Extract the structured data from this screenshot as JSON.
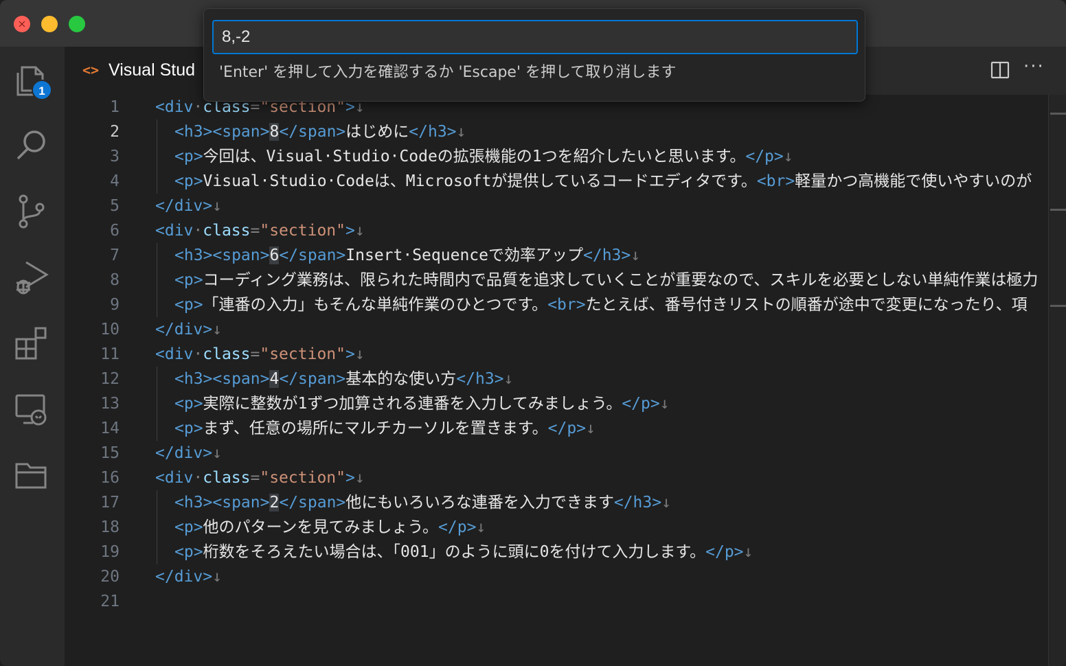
{
  "tab": {
    "label": "Visual Stud",
    "icon": "html-file-icon"
  },
  "activity_bar": {
    "items": [
      {
        "name": "explorer-icon",
        "badge": "1"
      },
      {
        "name": "search-icon"
      },
      {
        "name": "source-control-icon"
      },
      {
        "name": "run-debug-icon"
      },
      {
        "name": "extensions-icon"
      },
      {
        "name": "remote-explorer-icon"
      },
      {
        "name": "folder-icon"
      }
    ]
  },
  "quick_input": {
    "value": "8,-2",
    "hint": "'Enter' を押して入力を確認するか 'Escape' を押して取り消します"
  },
  "editor": {
    "active_line": 2,
    "lines": [
      {
        "n": "1",
        "indent": false,
        "parts": [
          [
            "tag",
            "<div"
          ],
          [
            "punct",
            "·"
          ],
          [
            "attr",
            "class"
          ],
          [
            "punct",
            "="
          ],
          [
            "str",
            "\"section\""
          ],
          [
            "tag",
            ">"
          ],
          [
            "eol",
            "↓"
          ]
        ]
      },
      {
        "n": "2",
        "indent": true,
        "parts": [
          [
            "tag",
            "<h3>"
          ],
          [
            "tag",
            "<span>"
          ],
          [
            "sel",
            "8"
          ],
          [
            "tag",
            "</span>"
          ],
          [
            "txt",
            "はじめに"
          ],
          [
            "tag",
            "</h3>"
          ],
          [
            "eol",
            "↓"
          ]
        ]
      },
      {
        "n": "3",
        "indent": true,
        "parts": [
          [
            "tag",
            "<p>"
          ],
          [
            "txt",
            "今回は、Visual·Studio·Codeの拡張機能の1つを紹介したいと思います。"
          ],
          [
            "tag",
            "</p>"
          ],
          [
            "eol",
            "↓"
          ]
        ]
      },
      {
        "n": "4",
        "indent": true,
        "parts": [
          [
            "tag",
            "<p>"
          ],
          [
            "txt",
            "Visual·Studio·Codeは、Microsoftが提供しているコードエディタです。"
          ],
          [
            "tag",
            "<br>"
          ],
          [
            "txt",
            "軽量かつ高機能で使いやすいのが"
          ]
        ]
      },
      {
        "n": "5",
        "indent": false,
        "parts": [
          [
            "tag",
            "</div>"
          ],
          [
            "eol",
            "↓"
          ]
        ]
      },
      {
        "n": "6",
        "indent": false,
        "parts": [
          [
            "tag",
            "<div"
          ],
          [
            "punct",
            "·"
          ],
          [
            "attr",
            "class"
          ],
          [
            "punct",
            "="
          ],
          [
            "str",
            "\"section\""
          ],
          [
            "tag",
            ">"
          ],
          [
            "eol",
            "↓"
          ]
        ]
      },
      {
        "n": "7",
        "indent": true,
        "parts": [
          [
            "tag",
            "<h3>"
          ],
          [
            "tag",
            "<span>"
          ],
          [
            "sel",
            "6"
          ],
          [
            "tag",
            "</span>"
          ],
          [
            "txt",
            "Insert·Sequenceで効率アップ"
          ],
          [
            "tag",
            "</h3>"
          ],
          [
            "eol",
            "↓"
          ]
        ]
      },
      {
        "n": "8",
        "indent": true,
        "parts": [
          [
            "tag",
            "<p>"
          ],
          [
            "txt",
            "コーディング業務は、限られた時間内で品質を追求していくことが重要なので、スキルを必要としない単純作業は極力"
          ]
        ]
      },
      {
        "n": "9",
        "indent": true,
        "parts": [
          [
            "tag",
            "<p>"
          ],
          [
            "txt",
            "「連番の入力」もそんな単純作業のひとつです。"
          ],
          [
            "tag",
            "<br>"
          ],
          [
            "txt",
            "たとえば、番号付きリストの順番が途中で変更になったり、項"
          ]
        ]
      },
      {
        "n": "10",
        "indent": false,
        "parts": [
          [
            "tag",
            "</div>"
          ],
          [
            "eol",
            "↓"
          ]
        ]
      },
      {
        "n": "11",
        "indent": false,
        "parts": [
          [
            "tag",
            "<div"
          ],
          [
            "punct",
            "·"
          ],
          [
            "attr",
            "class"
          ],
          [
            "punct",
            "="
          ],
          [
            "str",
            "\"section\""
          ],
          [
            "tag",
            ">"
          ],
          [
            "eol",
            "↓"
          ]
        ]
      },
      {
        "n": "12",
        "indent": true,
        "parts": [
          [
            "tag",
            "<h3>"
          ],
          [
            "tag",
            "<span>"
          ],
          [
            "sel",
            "4"
          ],
          [
            "tag",
            "</span>"
          ],
          [
            "txt",
            "基本的な使い方"
          ],
          [
            "tag",
            "</h3>"
          ],
          [
            "eol",
            "↓"
          ]
        ]
      },
      {
        "n": "13",
        "indent": true,
        "parts": [
          [
            "tag",
            "<p>"
          ],
          [
            "txt",
            "実際に整数が1ずつ加算される連番を入力してみましょう。"
          ],
          [
            "tag",
            "</p>"
          ],
          [
            "eol",
            "↓"
          ]
        ]
      },
      {
        "n": "14",
        "indent": true,
        "parts": [
          [
            "tag",
            "<p>"
          ],
          [
            "txt",
            "まず、任意の場所にマルチカーソルを置きます。"
          ],
          [
            "tag",
            "</p>"
          ],
          [
            "eol",
            "↓"
          ]
        ]
      },
      {
        "n": "15",
        "indent": false,
        "parts": [
          [
            "tag",
            "</div>"
          ],
          [
            "eol",
            "↓"
          ]
        ]
      },
      {
        "n": "16",
        "indent": false,
        "parts": [
          [
            "tag",
            "<div"
          ],
          [
            "punct",
            "·"
          ],
          [
            "attr",
            "class"
          ],
          [
            "punct",
            "="
          ],
          [
            "str",
            "\"section\""
          ],
          [
            "tag",
            ">"
          ],
          [
            "eol",
            "↓"
          ]
        ]
      },
      {
        "n": "17",
        "indent": true,
        "parts": [
          [
            "tag",
            "<h3>"
          ],
          [
            "tag",
            "<span>"
          ],
          [
            "sel",
            "2"
          ],
          [
            "tag",
            "</span>"
          ],
          [
            "txt",
            "他にもいろいろな連番を入力できます"
          ],
          [
            "tag",
            "</h3>"
          ],
          [
            "eol",
            "↓"
          ]
        ]
      },
      {
        "n": "18",
        "indent": true,
        "parts": [
          [
            "tag",
            "<p>"
          ],
          [
            "txt",
            "他のパターンを見てみましょう。"
          ],
          [
            "tag",
            "</p>"
          ],
          [
            "eol",
            "↓"
          ]
        ]
      },
      {
        "n": "19",
        "indent": true,
        "parts": [
          [
            "tag",
            "<p>"
          ],
          [
            "txt",
            "桁数をそろえたい場合は、「001」のように頭に0を付けて入力します。"
          ],
          [
            "tag",
            "</p>"
          ],
          [
            "eol",
            "↓"
          ]
        ]
      },
      {
        "n": "20",
        "indent": false,
        "parts": [
          [
            "tag",
            "</div>"
          ],
          [
            "eol",
            "↓"
          ]
        ]
      },
      {
        "n": "21",
        "indent": false,
        "parts": []
      }
    ]
  }
}
